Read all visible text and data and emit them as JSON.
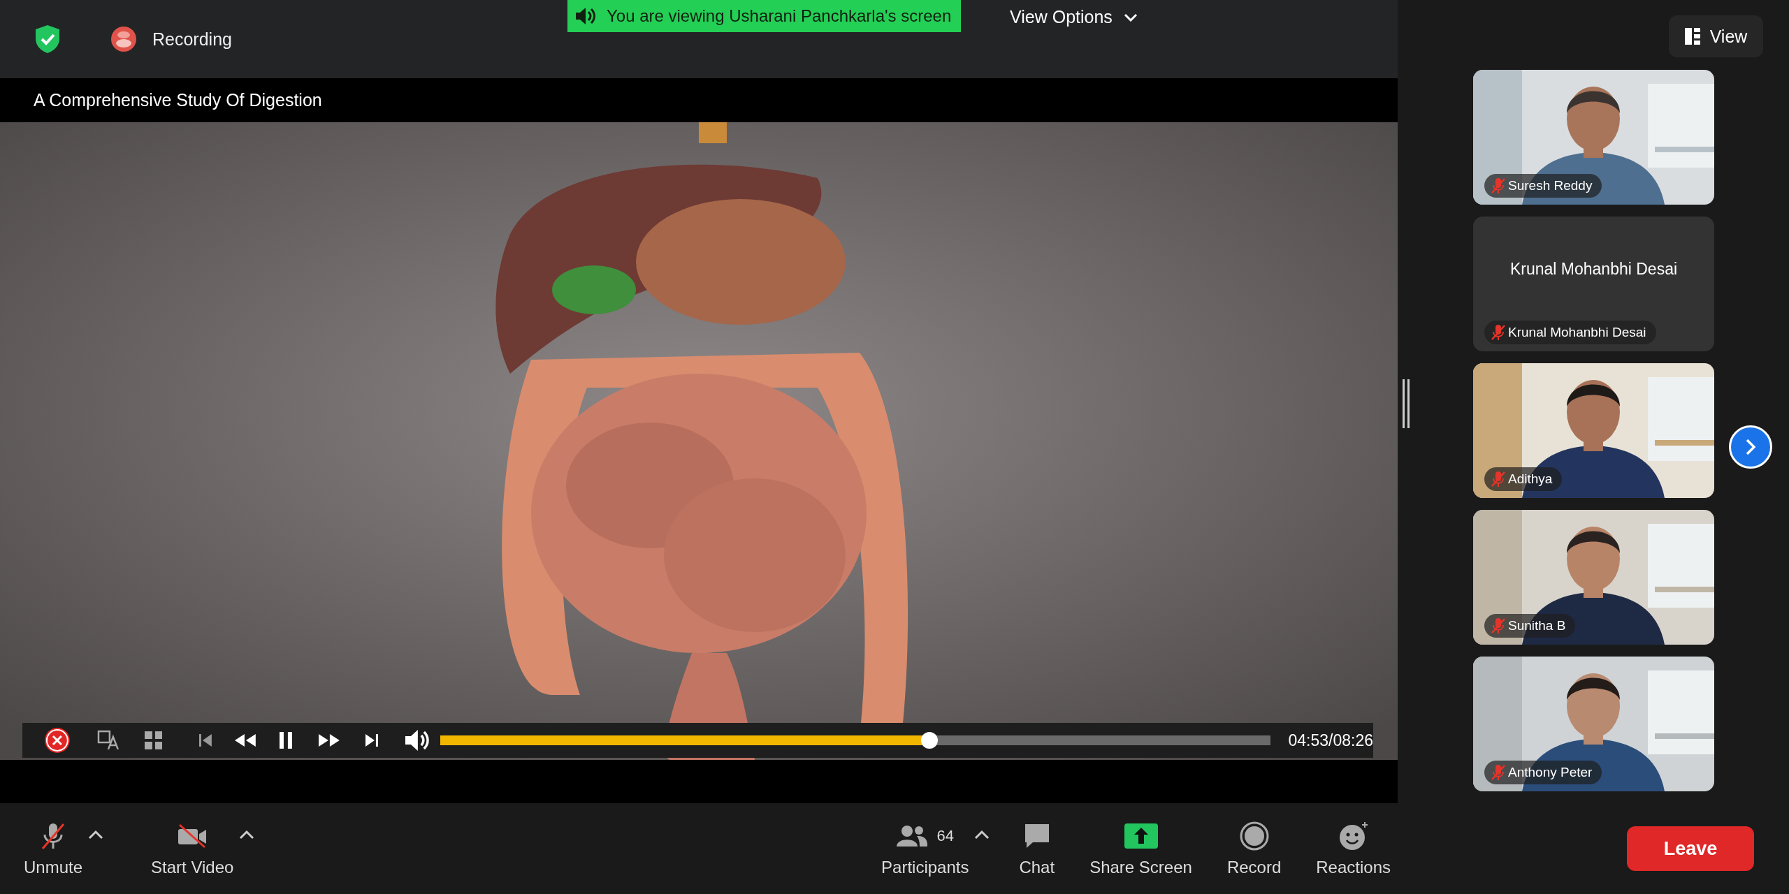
{
  "top_bar": {
    "recording": {
      "label": "Recording"
    },
    "share_banner": {
      "text": "You are viewing Usharani Panchkarla's screen"
    },
    "view_options": {
      "label": "View Options"
    }
  },
  "shared_screen": {
    "title": "A Comprehensive Study Of Digestion",
    "player": {
      "playing": true,
      "level": 0.59,
      "time": "04:53/08:26"
    }
  },
  "gallery": {
    "view_button": {
      "label": "View"
    },
    "participants": [
      {
        "name": "Suresh Reddy",
        "kind": "video",
        "muted": true
      },
      {
        "name": "Krunal Mohanbhi Desai",
        "kind": "name_only",
        "display_name": "Krunal Mohanbhi Desai",
        "muted": true
      },
      {
        "name": "Adithya",
        "kind": "video",
        "muted": true
      },
      {
        "name": "Sunitha B",
        "kind": "video",
        "muted": true
      },
      {
        "name": "Anthony Peter",
        "kind": "video",
        "muted": true
      }
    ]
  },
  "toolbar": {
    "items": [
      {
        "kind": "mic",
        "label": "Unmute",
        "off": true,
        "menu": true
      },
      {
        "kind": "video",
        "label": "Start Video",
        "off": true,
        "menu": true
      },
      {
        "kind": "participants",
        "label": "Participants",
        "count": "64",
        "menu": true
      },
      {
        "kind": "chat",
        "label": "Chat",
        "menu": false
      },
      {
        "kind": "share",
        "label": "Share Screen",
        "menu": false
      },
      {
        "kind": "record",
        "label": "Record",
        "menu": false
      },
      {
        "kind": "reactions",
        "label": "Reactions",
        "menu": false
      }
    ],
    "leave": {
      "label": "Leave"
    }
  }
}
